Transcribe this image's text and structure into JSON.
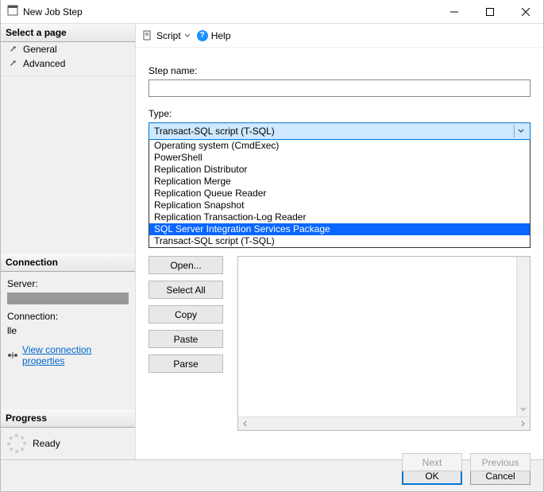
{
  "window": {
    "title": "New Job Step"
  },
  "sidebar": {
    "select_page_header": "Select a page",
    "pages": [
      {
        "label": "General"
      },
      {
        "label": "Advanced"
      }
    ],
    "connection_header": "Connection",
    "server_label": "Server:",
    "connection_label": "Connection:",
    "connection_value": "lle",
    "view_conn_link": "View connection properties",
    "progress_header": "Progress",
    "progress_status": "Ready"
  },
  "toolbar": {
    "script_label": "Script",
    "help_label": "Help"
  },
  "form": {
    "step_name_label": "Step name:",
    "step_name_value": "",
    "type_label": "Type:",
    "type_value": "Transact-SQL script (T-SQL)",
    "type_options": [
      "Operating system (CmdExec)",
      "PowerShell",
      "Replication Distributor",
      "Replication Merge",
      "Replication Queue Reader",
      "Replication Snapshot",
      "Replication Transaction-Log Reader",
      "SQL Server Integration Services Package",
      "Transact-SQL script (T-SQL)"
    ],
    "type_highlight_index": 7
  },
  "buttons": {
    "open": "Open...",
    "select_all": "Select All",
    "copy": "Copy",
    "paste": "Paste",
    "parse": "Parse",
    "next": "Next",
    "previous": "Previous",
    "ok": "OK",
    "cancel": "Cancel"
  }
}
